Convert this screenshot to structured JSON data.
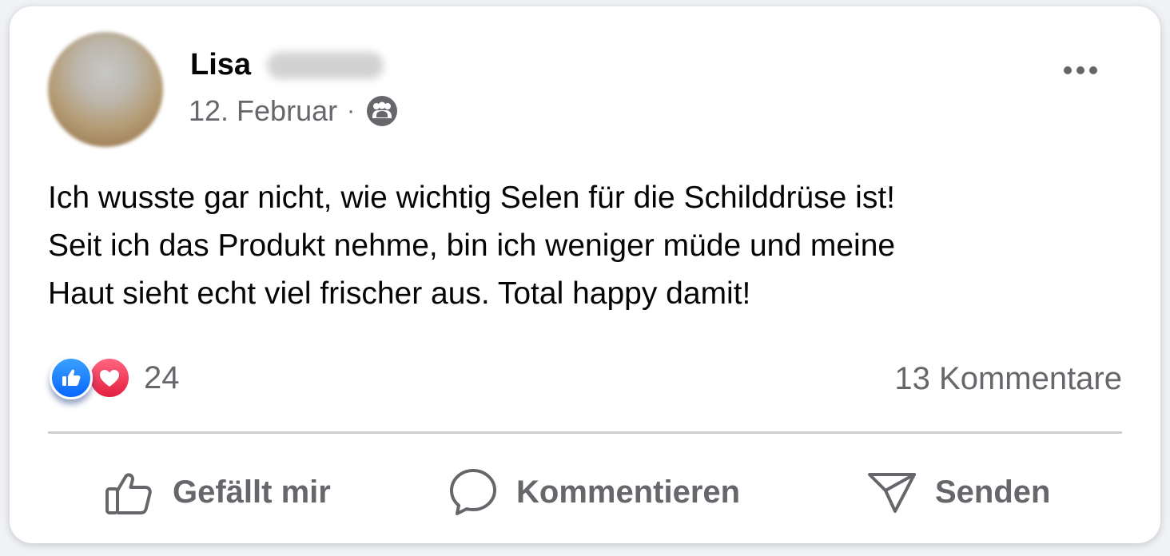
{
  "post": {
    "author_first_name": "Lisa",
    "date": "12. Februar",
    "separator": "·",
    "audience_icon": "friends-icon",
    "text_lines": [
      "Ich wusste gar nicht, wie wichtig Selen für die Schilddrüse ist!",
      "Seit ich das Produkt nehme, bin ich weniger müde und meine",
      "Haut sieht echt viel frischer aus. Total happy damit!"
    ],
    "reactions": {
      "icons": [
        "like-icon",
        "love-icon"
      ],
      "count": "24"
    },
    "comments_count": "13 Kommentare"
  },
  "actions": {
    "like_label": "Gefällt mir",
    "comment_label": "Kommentieren",
    "send_label": "Senden"
  },
  "colors": {
    "like_blue": "#0866ff",
    "love_red": "#e41e3f",
    "secondary_text": "#65676b",
    "primary_text": "#050505"
  }
}
